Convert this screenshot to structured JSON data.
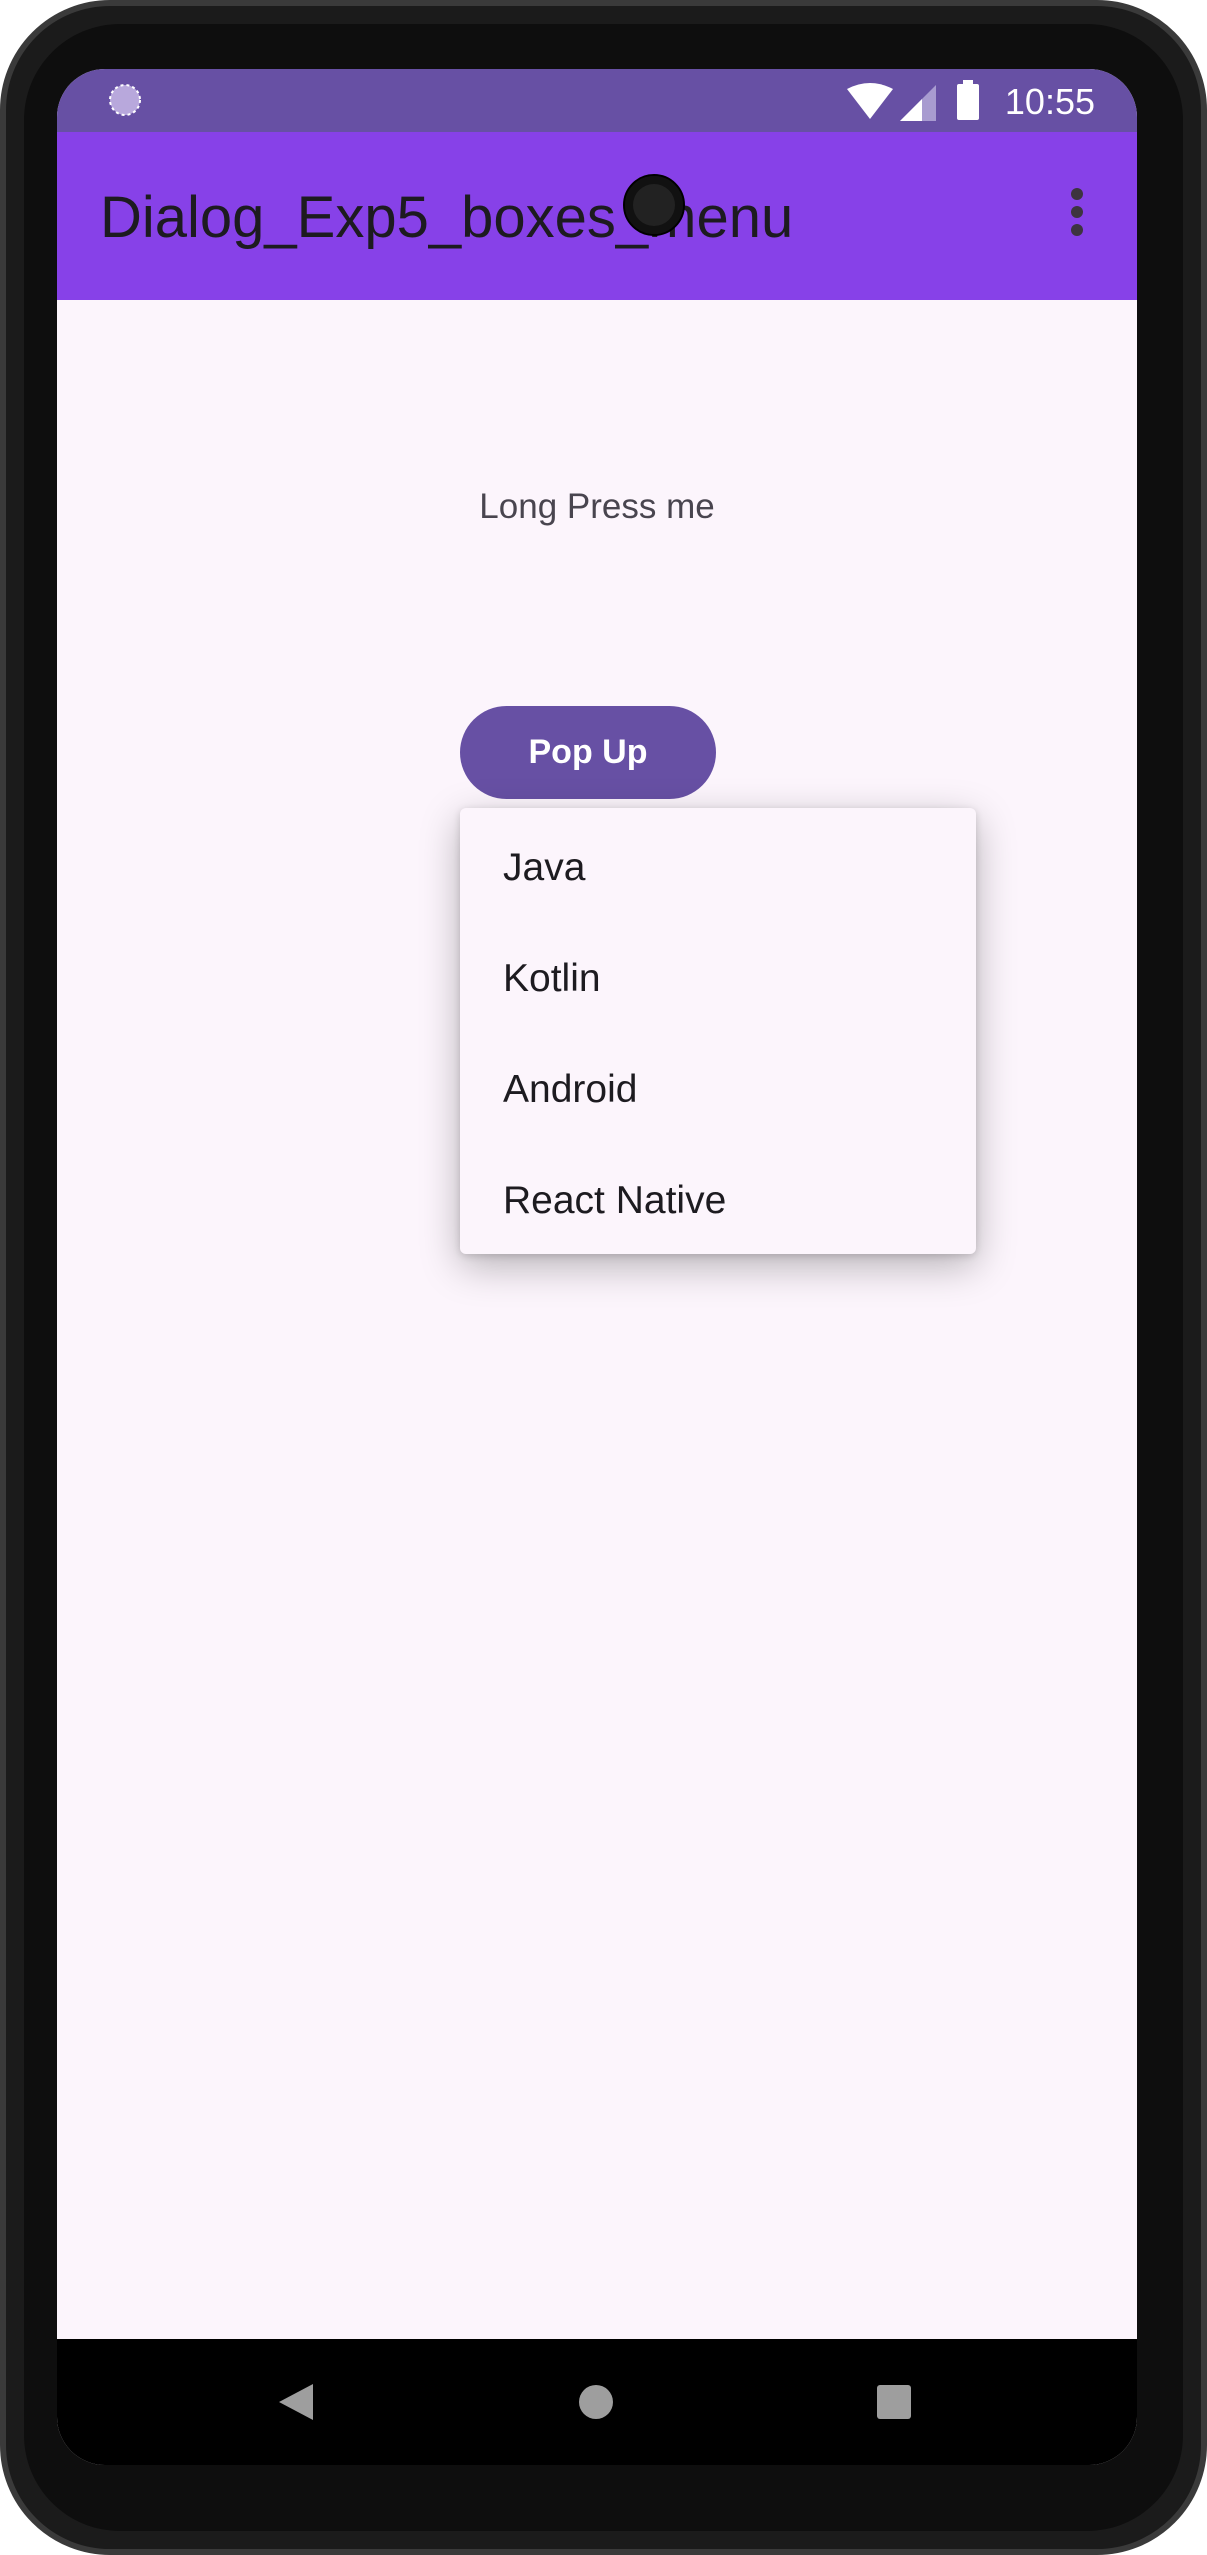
{
  "status_bar": {
    "time": "10:55",
    "icons": [
      "loading-icon",
      "wifi-icon",
      "signal-icon",
      "battery-icon"
    ]
  },
  "app_bar": {
    "title": "Dialog_Exp5_boxes_menu",
    "overflow_icon": "more-vert-icon"
  },
  "main": {
    "long_press_text": "Long Press me",
    "popup_button_label": "Pop Up",
    "popup_menu": {
      "items": [
        {
          "label": "Java"
        },
        {
          "label": "Kotlin"
        },
        {
          "label": "Android"
        },
        {
          "label": "React Native"
        }
      ]
    }
  },
  "nav_bar": {
    "icons": [
      "back-icon",
      "home-icon",
      "recents-icon"
    ]
  },
  "colors": {
    "status_bar": "#6750a4",
    "app_bar": "#8741e8",
    "button": "#6750a4",
    "background": "#fcf5fc"
  }
}
